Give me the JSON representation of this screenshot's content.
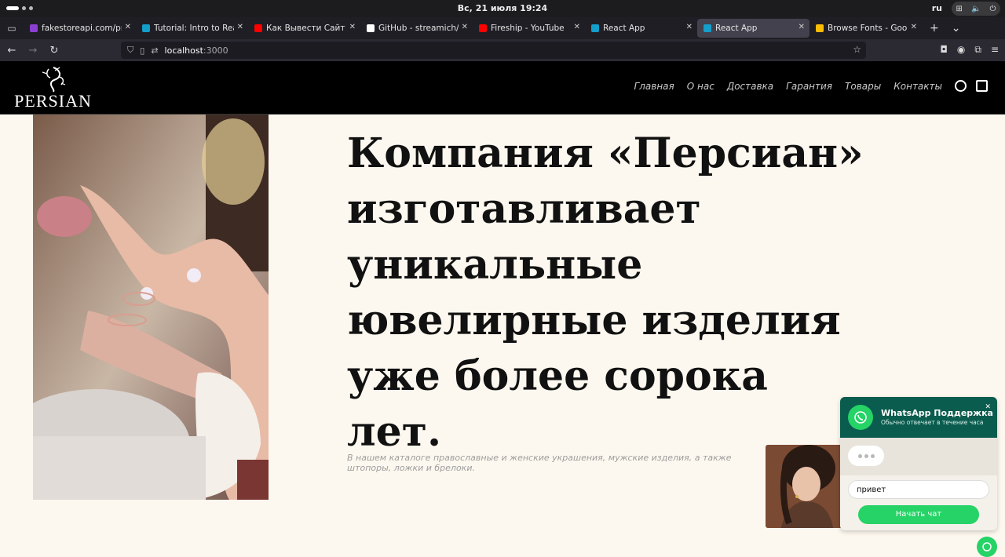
{
  "system": {
    "clock": "Вс, 21 июля  19:24",
    "lang": "ru"
  },
  "browser": {
    "tabs": [
      {
        "title": "fakestoreapi.com/prod",
        "favicon_color": "#8a3fd1",
        "active": false
      },
      {
        "title": "Tutorial: Intro to React –",
        "favicon_color": "#149eca",
        "active": false
      },
      {
        "title": "Как Вывести Сайт в ТОП",
        "favicon_color": "#ff0000",
        "active": false
      },
      {
        "title": "GitHub - streamich/reac",
        "favicon_color": "#ffffff",
        "active": false
      },
      {
        "title": "Fireship - YouTube",
        "favicon_color": "#ff0000",
        "active": false
      },
      {
        "title": "React App",
        "favicon_color": "#149eca",
        "active": false
      },
      {
        "title": "React App",
        "favicon_color": "#149eca",
        "active": true
      },
      {
        "title": "Browse Fonts - Google F",
        "favicon_color": "#fbbc04",
        "active": false
      }
    ],
    "url_host": "localhost",
    "url_port": ":3000"
  },
  "site": {
    "logo_text": "PERSIAN",
    "nav": [
      "Главная",
      "О нас",
      "Доставка",
      "Гарантия",
      "Товары",
      "Контакты"
    ],
    "headline": "Компания «Персиан» изготавливает уникальные ювелирные изделия уже более сорока лет.",
    "subtext": "В нашем каталоге православные и женские украшения, мужские изделия, а также штопоры, ложки и брелоки."
  },
  "whatsapp": {
    "title": "WhatsApp Поддержка",
    "subtitle": "Обычно отвечает в течение часа",
    "input_value": "привет",
    "start_label": "Начать чат",
    "brand_color": "#25d366",
    "header_color": "#0a5c4e"
  }
}
